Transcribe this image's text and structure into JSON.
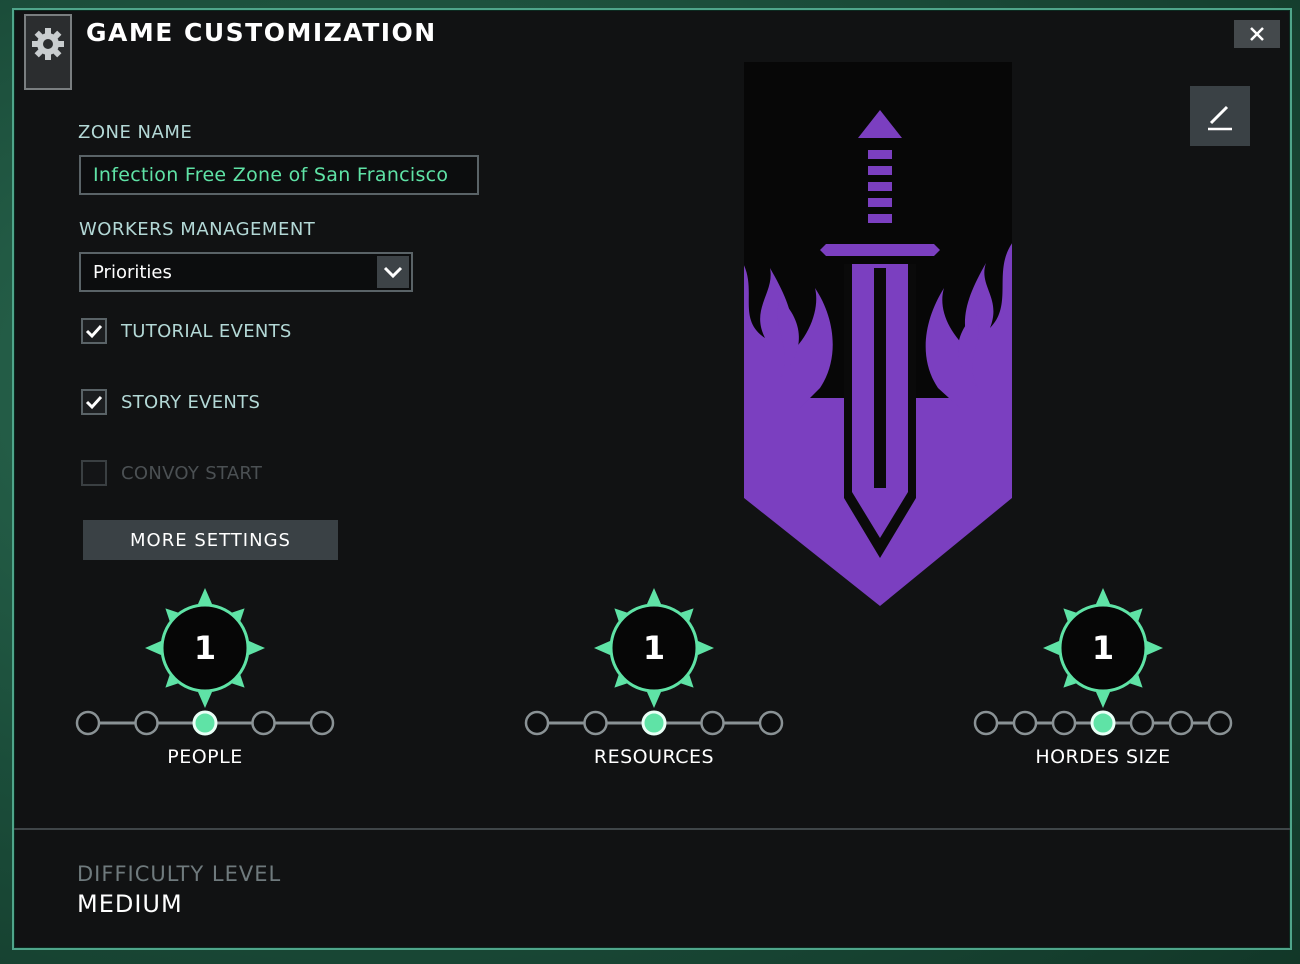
{
  "window": {
    "title": "GAME CUSTOMIZATION"
  },
  "zone": {
    "label": "ZONE NAME",
    "value": "Infection Free Zone of San Francisco"
  },
  "workers": {
    "label": "WORKERS MANAGEMENT",
    "selected": "Priorities"
  },
  "options": [
    {
      "label": "TUTORIAL EVENTS",
      "checked": true,
      "enabled": true
    },
    {
      "label": "STORY EVENTS",
      "checked": true,
      "enabled": true
    },
    {
      "label": "CONVOY START",
      "checked": false,
      "enabled": false
    }
  ],
  "more_settings": {
    "label": "MORE SETTINGS"
  },
  "settings": [
    {
      "label": "PEOPLE",
      "value": "1",
      "steps": 5,
      "selected_index": 2
    },
    {
      "label": "RESOURCES",
      "value": "1",
      "steps": 5,
      "selected_index": 2
    },
    {
      "label": "HORDES SIZE",
      "value": "1",
      "steps": 7,
      "selected_index": 3
    }
  ],
  "difficulty": {
    "label": "DIFFICULTY LEVEL",
    "value": "MEDIUM"
  },
  "icons": {
    "settings": "gear-icon",
    "close": "close-icon",
    "dropdown": "chevron-down-icon",
    "check": "checkmark-icon",
    "edit": "pencil-icon",
    "banner": "sword-flame-banner"
  },
  "colors": {
    "accent": "#5fe3a6",
    "banner_emblem": "#7b3fc0",
    "frame": "#4fa58a"
  }
}
